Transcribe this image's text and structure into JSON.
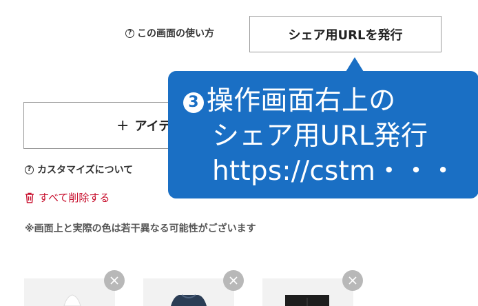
{
  "header": {
    "help_link": "この画面の使い方",
    "share_button": "シェア用URLを発行"
  },
  "actions": {
    "add_item_label": "アイテ"
  },
  "links": {
    "customize_about": "カスタマイズについて",
    "delete_all": "すべて削除する"
  },
  "note": "※画面上と実際の色は若干異なる可能性がございます",
  "callout": {
    "step_number": "3",
    "line1": "操作画面右上の",
    "line2": "シェア用URL発行",
    "line3": "https://cstm・・・"
  },
  "colors": {
    "callout_bg": "#1a6fc4",
    "delete_red": "#c8102e"
  },
  "icons": {
    "help": "question-circle-icon",
    "delete": "trash-icon",
    "remove": "close-icon",
    "add": "plus-icon"
  }
}
